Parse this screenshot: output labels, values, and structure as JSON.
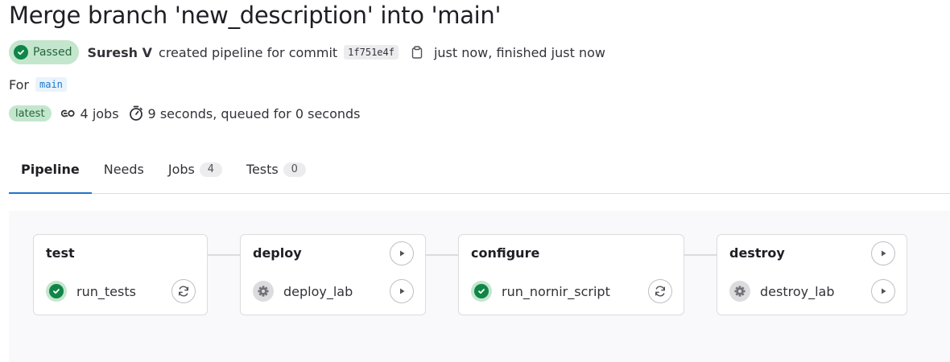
{
  "pipeline": {
    "title": "Merge branch 'new_description' into 'main'",
    "status_label": "Passed",
    "author": "Suresh V",
    "action_text": "created pipeline for commit",
    "commit_sha": "1f751e4f",
    "time_text": "just now, finished just now",
    "for_label": "For",
    "branch": "main",
    "latest_label": "latest",
    "jobs_text": "4 jobs",
    "duration_text": "9 seconds, queued for 0 seconds"
  },
  "tabs": [
    {
      "label": "Pipeline",
      "count": null,
      "active": true
    },
    {
      "label": "Needs",
      "count": null,
      "active": false
    },
    {
      "label": "Jobs",
      "count": "4",
      "active": false
    },
    {
      "label": "Tests",
      "count": "0",
      "active": false
    }
  ],
  "stages": [
    {
      "name": "test",
      "job": {
        "name": "run_tests",
        "status": "success",
        "action": "retry-icon"
      },
      "stage_action": null
    },
    {
      "name": "deploy",
      "job": {
        "name": "deploy_lab",
        "status": "manual",
        "action": "play-icon"
      },
      "stage_action": "play-icon"
    },
    {
      "name": "configure",
      "job": {
        "name": "run_nornir_script",
        "status": "success",
        "action": "retry-icon"
      },
      "stage_action": null
    },
    {
      "name": "destroy",
      "job": {
        "name": "destroy_lab",
        "status": "manual",
        "action": "play-icon"
      },
      "stage_action": "play-icon"
    }
  ],
  "colors": {
    "success": "#108548",
    "success_bg": "#c3e6cd",
    "accent": "#1f75cb",
    "manual_bg": "#dcdcde"
  }
}
